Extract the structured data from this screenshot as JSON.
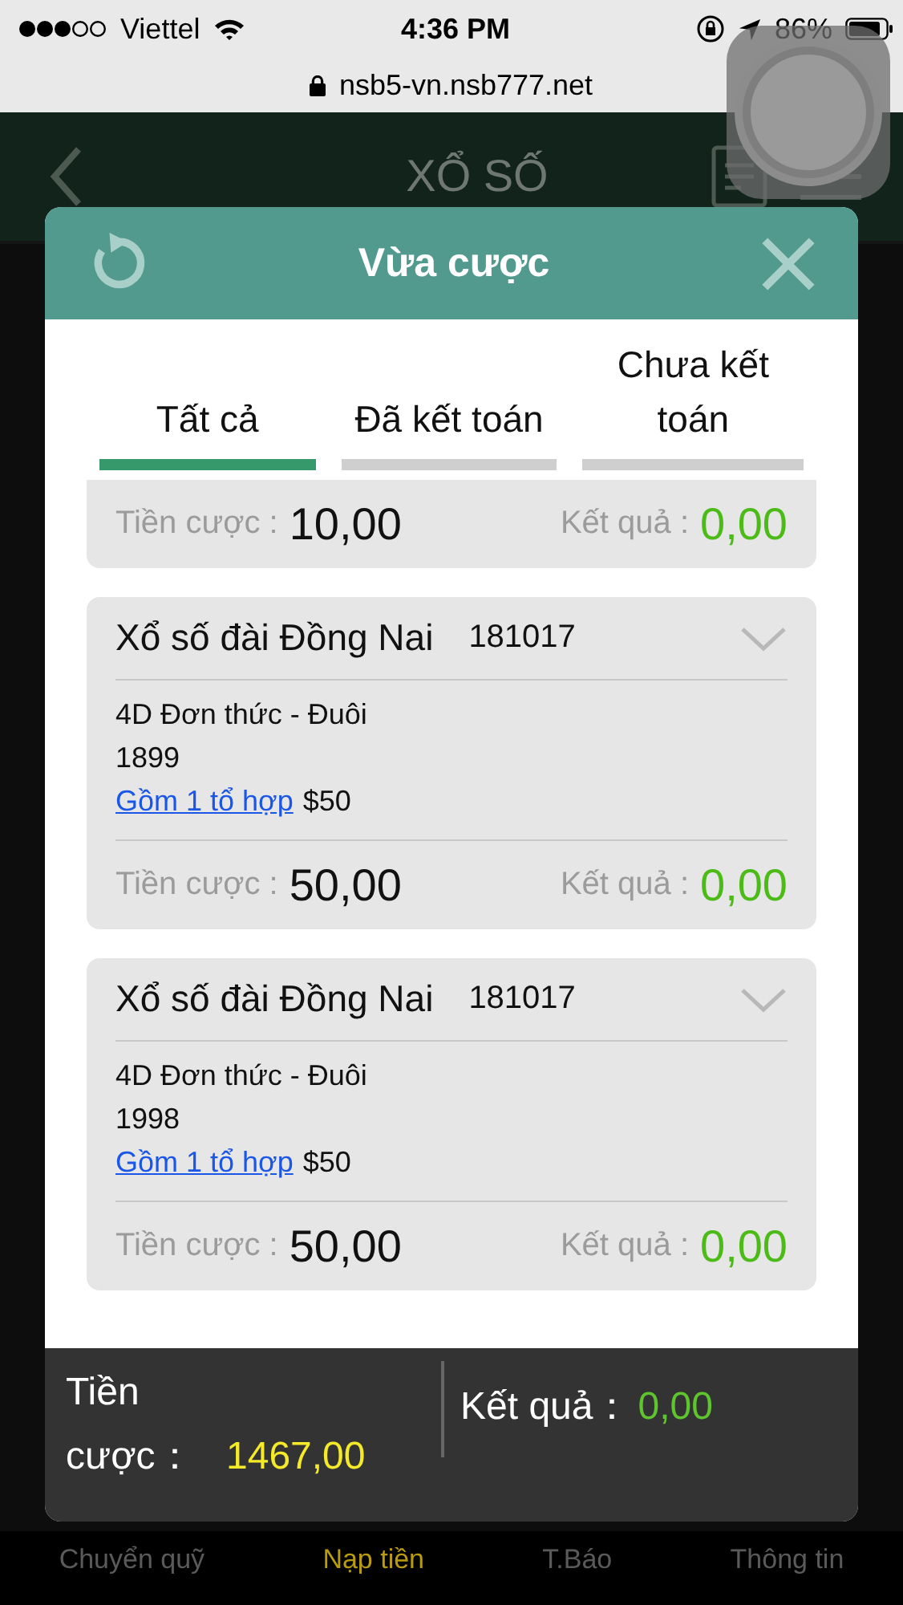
{
  "status_bar": {
    "carrier": "Viettel",
    "time": "4:36 PM",
    "battery": "86%"
  },
  "url_bar": {
    "url": "nsb5-vn.nsb777.net"
  },
  "app_header": {
    "title": "XỔ SỐ"
  },
  "modal": {
    "title": "Vừa cược",
    "tabs": [
      {
        "label": "Tất cả",
        "selected": true
      },
      {
        "label": "Đã kết toán",
        "selected": false
      },
      {
        "label": "Chưa kết toán",
        "selected": false
      }
    ],
    "bets": [
      {
        "kind": "stake_only",
        "stake_label": "Tiền cược :",
        "stake": "10,00",
        "result_label": "Kết quả :",
        "result": "0,00"
      },
      {
        "kind": "full",
        "title": "Xổ số đài Đồng Nai",
        "draw_no": "181017",
        "bet_type": "4D Đơn thức - Đuôi",
        "numbers": "1899",
        "combo_link": "Gồm 1 tổ hợp",
        "amount": "$50",
        "stake_label": "Tiền cược :",
        "stake": "50,00",
        "result_label": "Kết quả :",
        "result": "0,00"
      },
      {
        "kind": "full",
        "title": "Xổ số đài Đồng Nai",
        "draw_no": "181017",
        "bet_type": "4D Đơn thức - Đuôi",
        "numbers": "1998",
        "combo_link": "Gồm 1 tổ hợp",
        "amount": "$50",
        "stake_label": "Tiền cược :",
        "stake": "50,00",
        "result_label": "Kết quả :",
        "result": "0,00"
      }
    ],
    "summary": {
      "stake_label": "Tiền cược：",
      "stake": "1467,00",
      "result_label": "Kết quả：",
      "result": "0,00"
    }
  },
  "bottom_nav": [
    {
      "label": "Chuyển quỹ",
      "selected": false
    },
    {
      "label": "Nạp tiền",
      "selected": true
    },
    {
      "label": "T.Báo",
      "selected": false
    },
    {
      "label": "Thông tin",
      "selected": false
    }
  ]
}
